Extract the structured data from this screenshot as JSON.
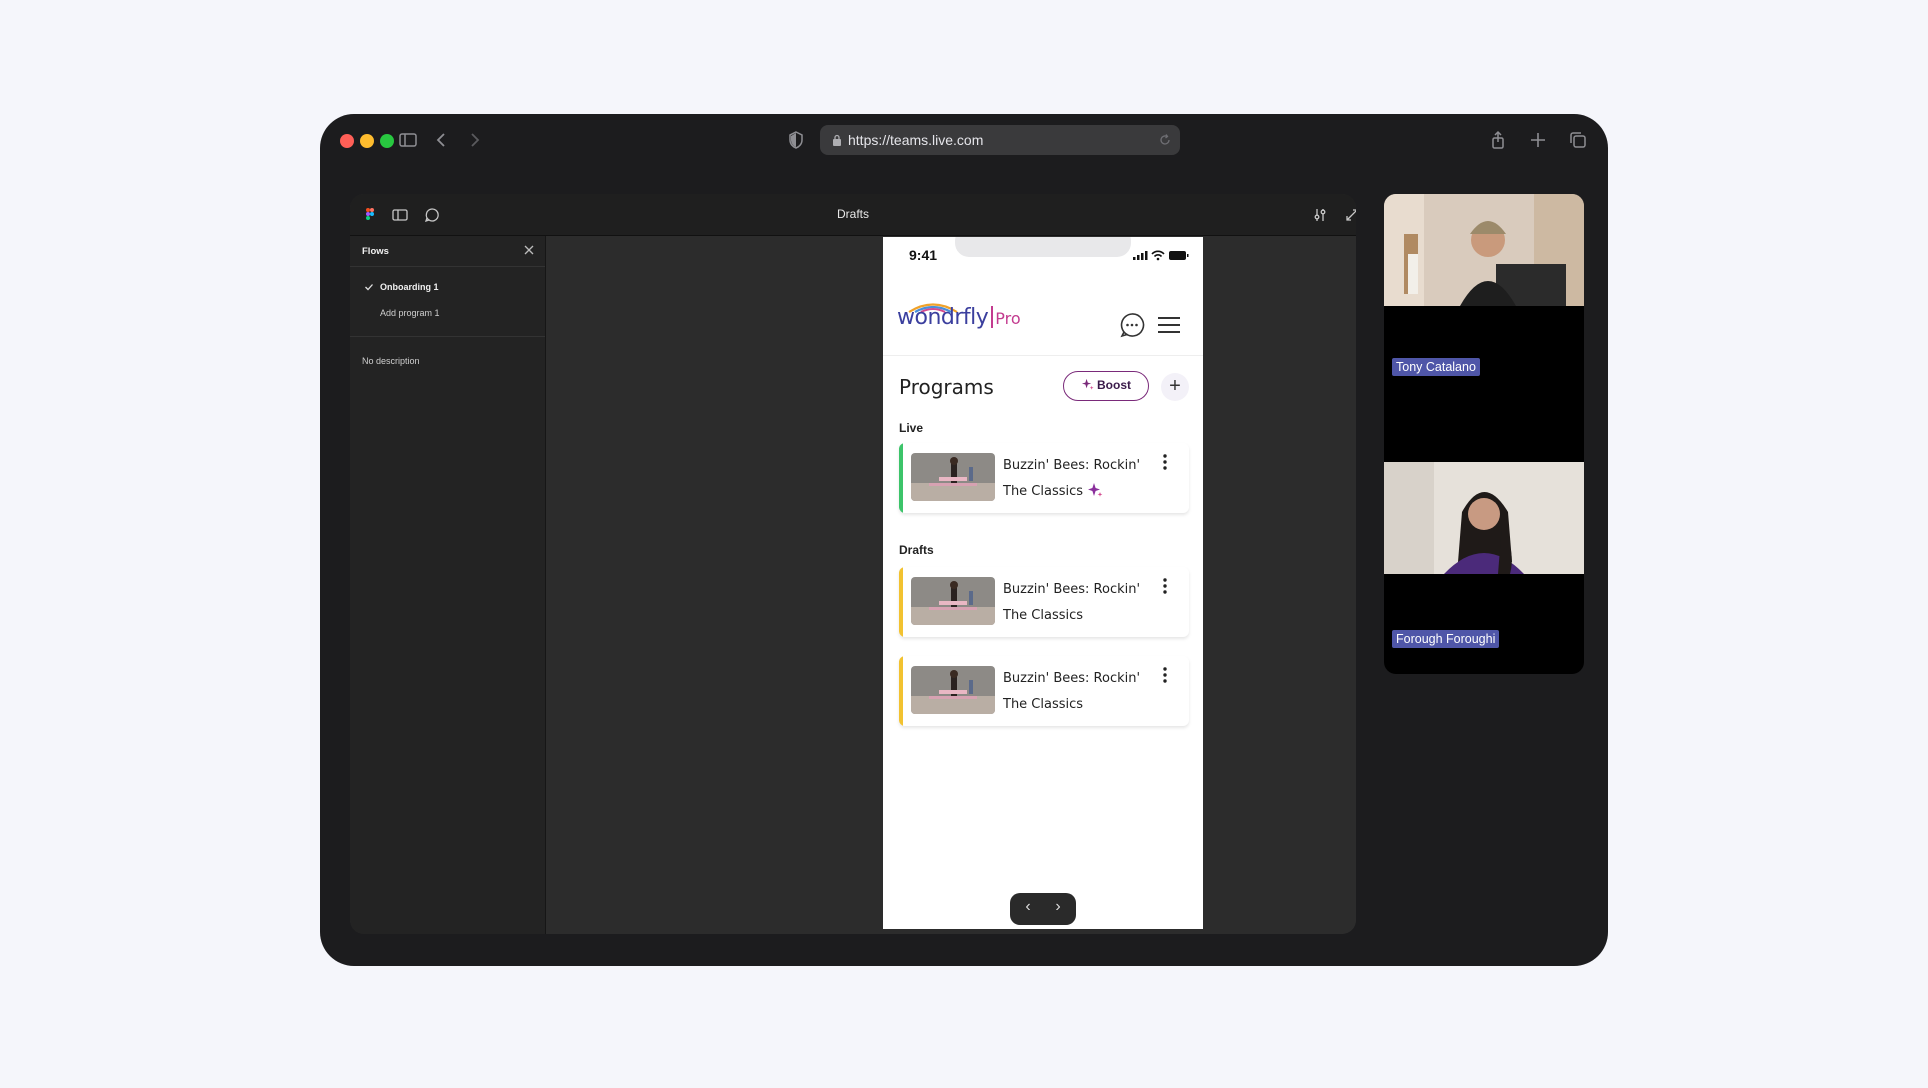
{
  "browser": {
    "url": "https://teams.live.com"
  },
  "figma": {
    "title": "Drafts",
    "sidebar": {
      "header": "Flows",
      "items": [
        {
          "label": "Onboarding 1",
          "checked": true
        },
        {
          "label": "Add program 1",
          "checked": false
        }
      ],
      "description": "No description"
    }
  },
  "app": {
    "status_time": "9:41",
    "logo_word": "wondrfly",
    "logo_suffix": "Pro",
    "heading": "Programs",
    "boost_label": "Boost",
    "plus_label": "+",
    "sections": [
      {
        "label": "Live",
        "stripe_color": "#3cc46a",
        "cards": [
          {
            "line1": "Buzzin' Bees: Rockin'",
            "line2": "The Classics",
            "boosted": true
          }
        ]
      },
      {
        "label": "Drafts",
        "stripe_color": "#f2c230",
        "cards": [
          {
            "line1": "Buzzin' Bees: Rockin'",
            "line2": "The Classics",
            "boosted": false
          },
          {
            "line1": "Buzzin' Bees: Rockin'",
            "line2": "The Classics",
            "boosted": false
          }
        ]
      }
    ],
    "nav": {
      "prev": "‹",
      "next": "›"
    }
  },
  "participants": [
    {
      "name": "Tony Catalano"
    },
    {
      "name": "Forough Foroughi"
    }
  ],
  "colors": {
    "accent_purple": "#4f56a8",
    "boost_border": "#7a2a7a"
  }
}
